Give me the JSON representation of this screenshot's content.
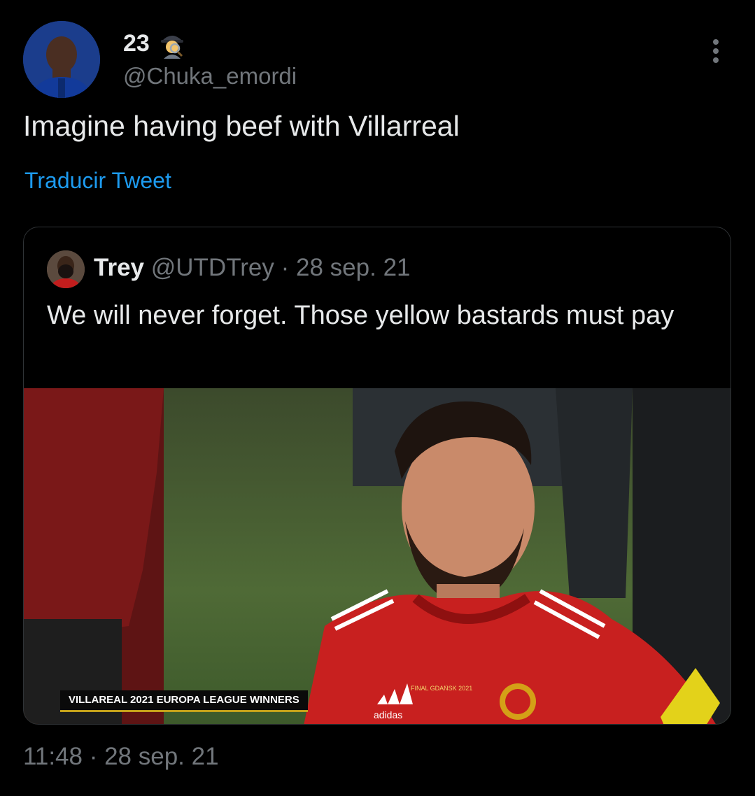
{
  "author": {
    "display_name": "23",
    "handle": "@Chuka_emordi",
    "name_emoji": "detective-emoji"
  },
  "tweet": {
    "text": "Imagine having beef with Villarreal",
    "translate_label": "Traducir Tweet",
    "timestamp": "11:48 · 28 sep. 21"
  },
  "quoted": {
    "display_name": "Trey",
    "handle": "@UTDTrey",
    "separator": "·",
    "date": "28 sep. 21",
    "text": "We will never forget. Those yellow bastards must pay",
    "media": {
      "caption": "VILLAREAL 2021 EUROPA LEAGUE WINNERS",
      "jersey_text": "FINAL GDAŃSK 2021",
      "brand": "adidas"
    }
  },
  "colors": {
    "background": "#000000",
    "text": "#e7e9ea",
    "muted": "#71767b",
    "link": "#1d9bf0",
    "border": "#2f3336"
  }
}
